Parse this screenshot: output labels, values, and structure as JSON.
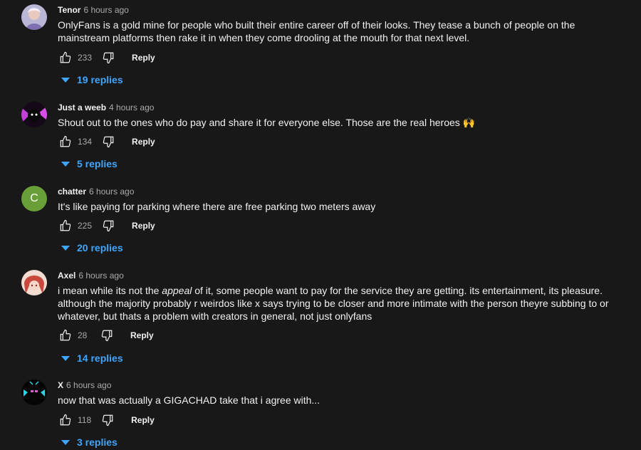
{
  "comments": [
    {
      "author": "Tenor",
      "time": "6 hours ago",
      "text": "OnlyFans is a gold mine for people who built their entire career off of their looks. They tease a bunch of people on the mainstream platforms then rake it in when they come drooling at the mouth for that next level.",
      "likes": "233",
      "reply_label": "Reply",
      "replies_label": "19 replies",
      "avatar_color": "#8d7fb8"
    },
    {
      "author": "Just a weeb",
      "time": "4 hours ago",
      "text": "Shout out to the ones who do pay and share it for everyone else. Those are the real heroes 🙌",
      "likes": "134",
      "reply_label": "Reply",
      "replies_label": "5 replies",
      "avatar_color": "#2a1030"
    },
    {
      "author": "chatter",
      "time": "6 hours ago",
      "text": "It's like paying for parking where there are free parking two meters away",
      "likes": "225",
      "reply_label": "Reply",
      "replies_label": "20 replies",
      "avatar_letter": "C",
      "avatar_color": "#689f38"
    },
    {
      "author": "Axel",
      "time": "6 hours ago",
      "text_before": "i mean while its not the ",
      "text_emph": "appeal",
      "text_after": " of it, some people want to pay for the service they are getting. its entertainment, its pleasure. although the majority probably r weirdos like x says trying to be closer and more intimate with the person theyre subbing to or whatever, but thats a problem with creators in general, not just onlyfans",
      "likes": "28",
      "reply_label": "Reply",
      "replies_label": "14 replies",
      "avatar_color": "#c8574a"
    },
    {
      "author": "X",
      "time": "6 hours ago",
      "text": "now that was actually a GIGACHAD take that i agree with...",
      "likes": "118",
      "reply_label": "Reply",
      "replies_label": "3 replies",
      "avatar_color": "#0b0b0b"
    }
  ]
}
